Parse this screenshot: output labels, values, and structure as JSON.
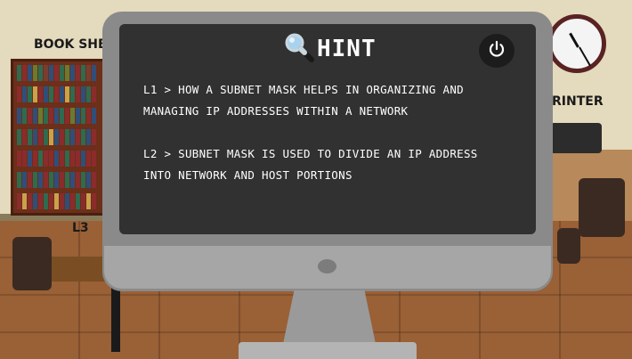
{
  "room": {
    "bookshelf_sign": "BOOK SHE",
    "printer_sign": "RINTER",
    "table_label": "L3"
  },
  "hint": {
    "title": "HINT",
    "title_icon": "magnifier-icon",
    "close_icon": "power-icon",
    "lines": [
      "L1 > HOW A SUBNET MASK HELPS IN ORGANIZING AND",
      "MANAGING IP ADDRESSES WITHIN A NETWORK",
      "L2 >  SUBNET MASK IS USED TO DIVIDE AN IP ADDRESS",
      "INTO NETWORK AND HOST PORTIONS"
    ]
  },
  "colors": {
    "screen": "#313131",
    "monitor_frame": "#8a8a8a",
    "text": "#ffffff",
    "floor": "#9a6036"
  }
}
